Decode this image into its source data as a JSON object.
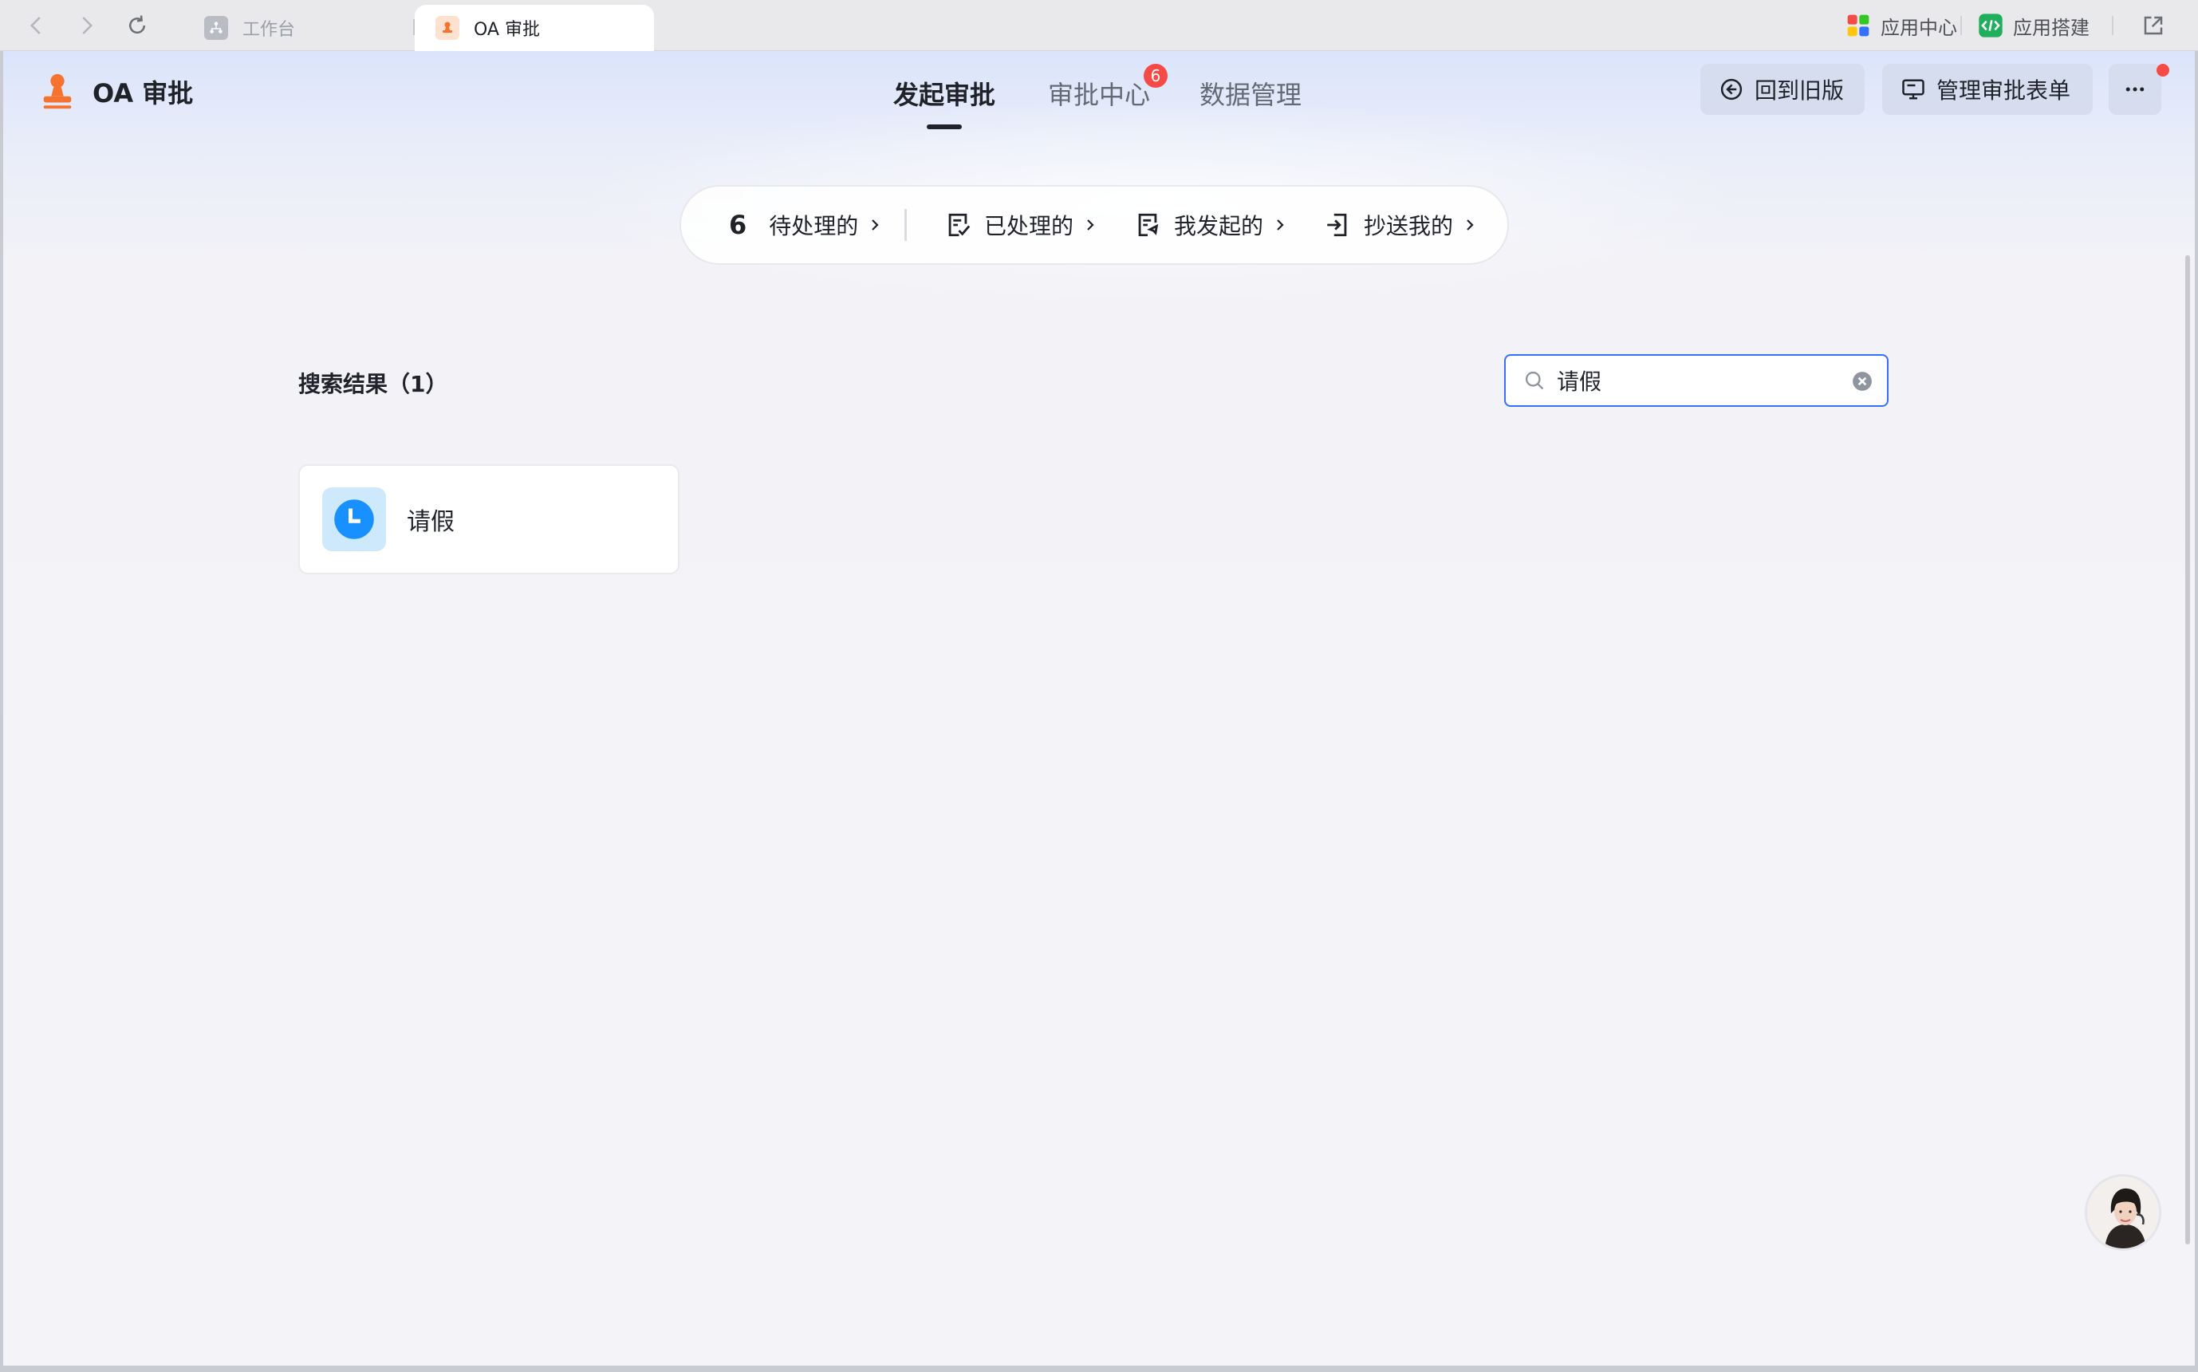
{
  "browser": {
    "tabs": [
      {
        "label": "工作台",
        "active": false
      },
      {
        "label": "OA 审批",
        "active": true
      }
    ],
    "top_right": {
      "app_center": "应用中心",
      "app_builder": "应用搭建"
    }
  },
  "app": {
    "name": "OA 审批",
    "main_tabs": [
      {
        "label": "发起审批",
        "active": true
      },
      {
        "label": "审批中心",
        "active": false,
        "badge": "6"
      },
      {
        "label": "数据管理",
        "active": false
      }
    ],
    "header_buttons": {
      "back_to_old": "回到旧版",
      "manage_forms": "管理审批表单"
    },
    "quick_filters": {
      "pending_count": "6",
      "pending": "待处理的",
      "processed": "已处理的",
      "initiated": "我发起的",
      "cc_me": "抄送我的"
    },
    "search": {
      "results_title": "搜索结果（1）",
      "query": "请假"
    },
    "results": [
      {
        "label": "请假",
        "icon": "clock-icon"
      }
    ]
  },
  "colors": {
    "accent": "#3370ff",
    "badge": "#f54a45",
    "logo": "#f5732f",
    "card_icon": "#1890ff"
  }
}
